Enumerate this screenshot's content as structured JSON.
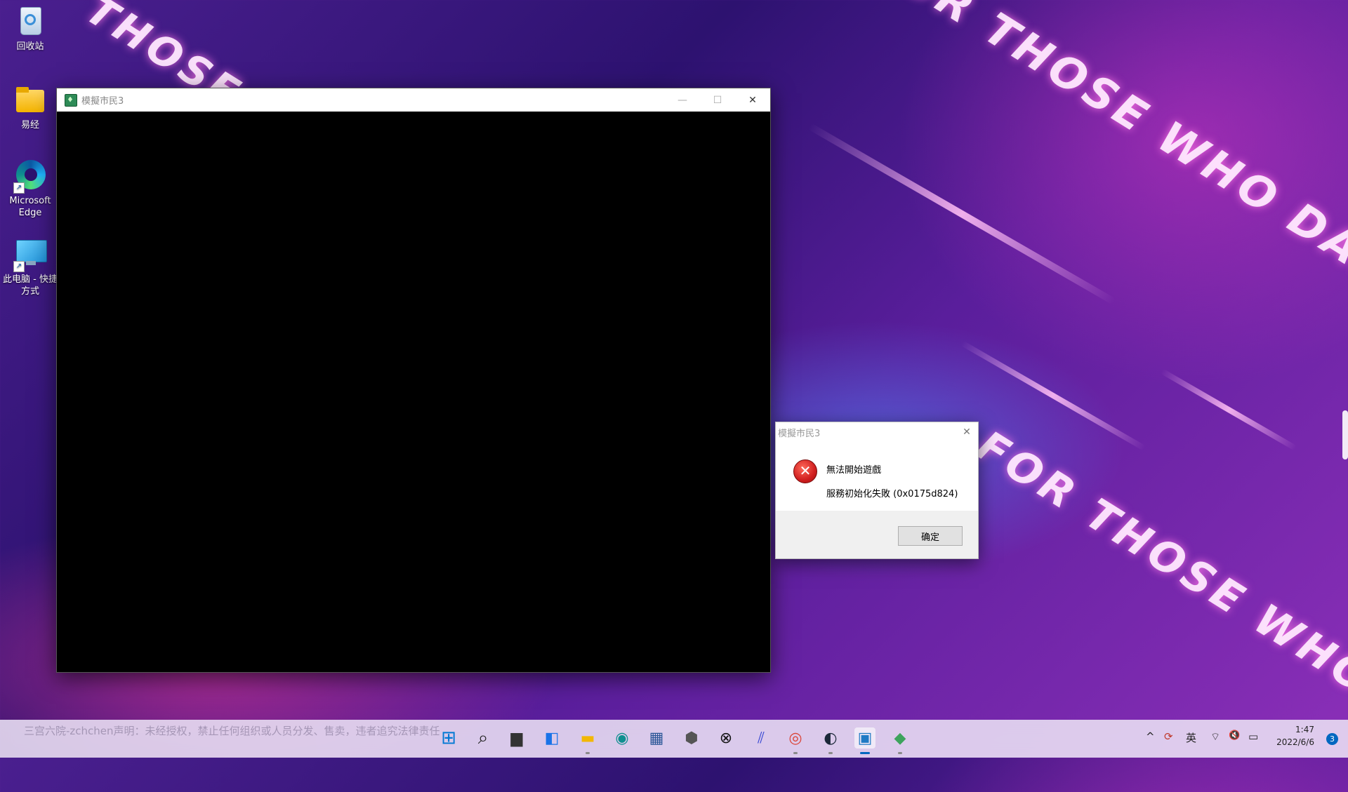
{
  "desktop": {
    "icons": [
      {
        "label": "回收站"
      },
      {
        "label": "易经"
      },
      {
        "label": "Microsoft Edge"
      },
      {
        "label": "此电脑 - 快捷方式"
      }
    ]
  },
  "game_window": {
    "title": "模擬市民3",
    "minimize_glyph": "—",
    "maximize_glyph": "☐",
    "close_glyph": "✕"
  },
  "dialog": {
    "title": "模擬市民3",
    "close_glyph": "✕",
    "message_primary": "無法開始遊戲",
    "message_secondary": "服務初始化失敗 (0x0175d824)",
    "ok_label": "确定",
    "icon": "error-icon"
  },
  "taskbar": {
    "notice": "三宫六院-zchchen声明：未经授权，禁止任何组织或人员分发、售卖，违者追究法律责任",
    "apps": [
      {
        "name": "start-icon",
        "glyph": "⊞",
        "color": "#0078d4"
      },
      {
        "name": "search-icon",
        "glyph": "⌕",
        "color": "#222222"
      },
      {
        "name": "task-view-icon",
        "glyph": "▆",
        "color": "#333333"
      },
      {
        "name": "widgets-icon",
        "glyph": "◧",
        "color": "#1a73e8"
      },
      {
        "name": "file-explorer-icon",
        "glyph": "▬",
        "color": "#f2b705"
      },
      {
        "name": "edge-icon",
        "glyph": "◉",
        "color": "#0f8f8f"
      },
      {
        "name": "store-icon",
        "glyph": "▦",
        "color": "#2b5797"
      },
      {
        "name": "cube-app-icon",
        "glyph": "⬢",
        "color": "#555555"
      },
      {
        "name": "xbox-icon",
        "glyph": "⊗",
        "color": "#111111"
      },
      {
        "name": "app-blue-icon",
        "glyph": "⫽",
        "color": "#3a4ad4"
      },
      {
        "name": "chrome-icon",
        "glyph": "◎",
        "color": "#db4437"
      },
      {
        "name": "steam-icon",
        "glyph": "◐",
        "color": "#1b2838"
      },
      {
        "name": "sims3-running-icon",
        "glyph": "▣",
        "color": "#1f7ac4"
      },
      {
        "name": "sims3-launcher-icon",
        "glyph": "◆",
        "color": "#3da35d"
      }
    ],
    "tray": {
      "chevron": "^",
      "sync": "⟳",
      "ime": "英",
      "wifi": "⌔",
      "volume": "🔇",
      "battery": "▭"
    },
    "time": "1:47",
    "date": "2022/6/6",
    "notification_count": "3"
  },
  "wallpaper": {
    "slogan": "FOR THOSE WHO DARE",
    "slogan_short": "THOSE"
  }
}
